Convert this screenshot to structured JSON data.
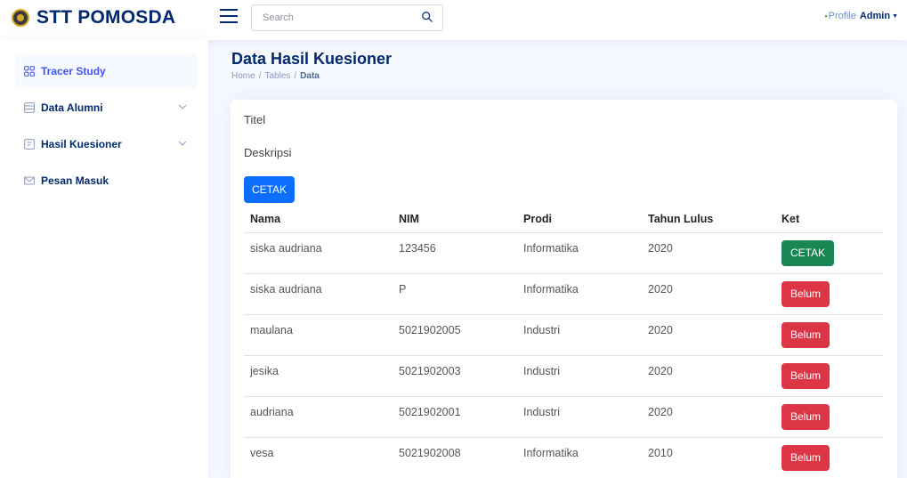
{
  "header": {
    "brand": "STT POMOSDA",
    "search_placeholder": "Search",
    "profile_img_alt": "Profile",
    "user_name": "Admin"
  },
  "sidebar": {
    "items": [
      {
        "label": "Tracer Study",
        "icon": "grid-icon",
        "active": true
      },
      {
        "label": "Data Alumni",
        "icon": "layout-icon",
        "has_chevron": true
      },
      {
        "label": "Hasil Kuesioner",
        "icon": "form-icon",
        "has_chevron": true
      },
      {
        "label": "Pesan Masuk",
        "icon": "envelope-icon"
      }
    ]
  },
  "page": {
    "title": "Data Hasil Kuesioner",
    "breadcrumb": [
      "Home",
      "Tables",
      "Data"
    ]
  },
  "card": {
    "titel_label": "Titel",
    "deskripsi_label": "Deskripsi",
    "cetak_button": "CETAK"
  },
  "table": {
    "headers": [
      "Nama",
      "NIM",
      "Prodi",
      "Tahun Lulus",
      "Ket"
    ],
    "rows": [
      {
        "nama": "siska audriana",
        "nim": "123456",
        "prodi": "Informatika",
        "tahun": "2020",
        "ket": "CETAK",
        "status": "success"
      },
      {
        "nama": "siska audriana",
        "nim": "P",
        "prodi": "Informatika",
        "tahun": "2020",
        "ket": "Belum",
        "status": "danger"
      },
      {
        "nama": "maulana",
        "nim": "5021902005",
        "prodi": "Industri",
        "tahun": "2020",
        "ket": "Belum",
        "status": "danger"
      },
      {
        "nama": "jesika",
        "nim": "5021902003",
        "prodi": "Industri",
        "tahun": "2020",
        "ket": "Belum",
        "status": "danger"
      },
      {
        "nama": "audriana",
        "nim": "5021902001",
        "prodi": "Industri",
        "tahun": "2020",
        "ket": "Belum",
        "status": "danger"
      },
      {
        "nama": "vesa",
        "nim": "5021902008",
        "prodi": "Informatika",
        "tahun": "2010",
        "ket": "Belum",
        "status": "danger"
      }
    ]
  },
  "colors": {
    "brand": "#012970",
    "primary": "#0d6efd",
    "success": "#198754",
    "danger": "#dc3545"
  }
}
